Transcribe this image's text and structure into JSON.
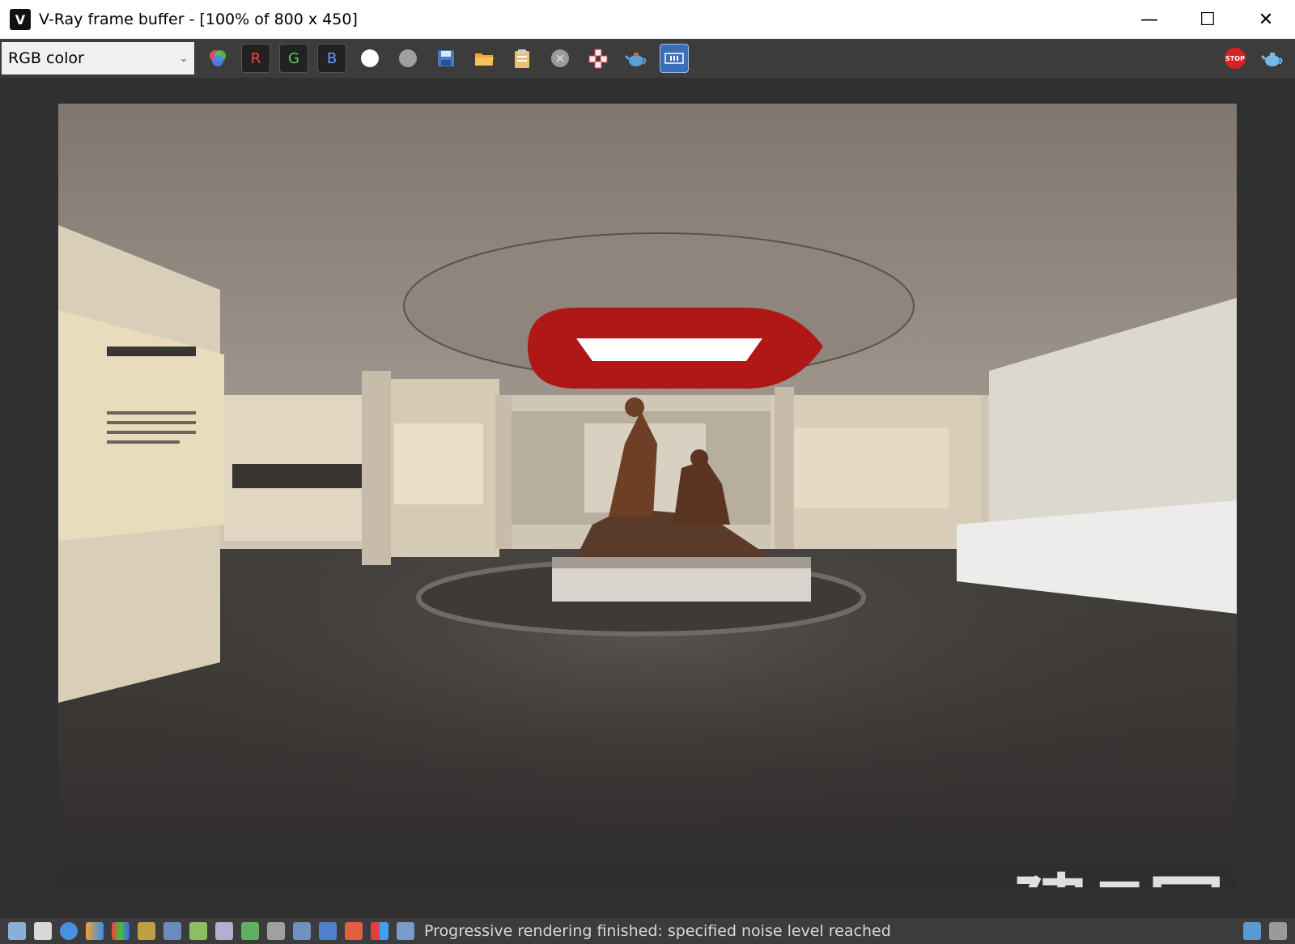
{
  "window": {
    "title": "V-Ray frame buffer - [100% of 800 x 450]",
    "app_icon": "vray-logo-icon",
    "minimize": "—",
    "maximize": "☐",
    "close": "✕"
  },
  "toolbar": {
    "channel": "RGB color",
    "channel_arrow": "⌄",
    "r_label": "R",
    "g_label": "G",
    "b_label": "B",
    "stop_label": "STOP"
  },
  "render": {
    "watermark_big": "建E网"
  },
  "status": {
    "text": "Progressive rendering finished: specified noise level reached"
  }
}
